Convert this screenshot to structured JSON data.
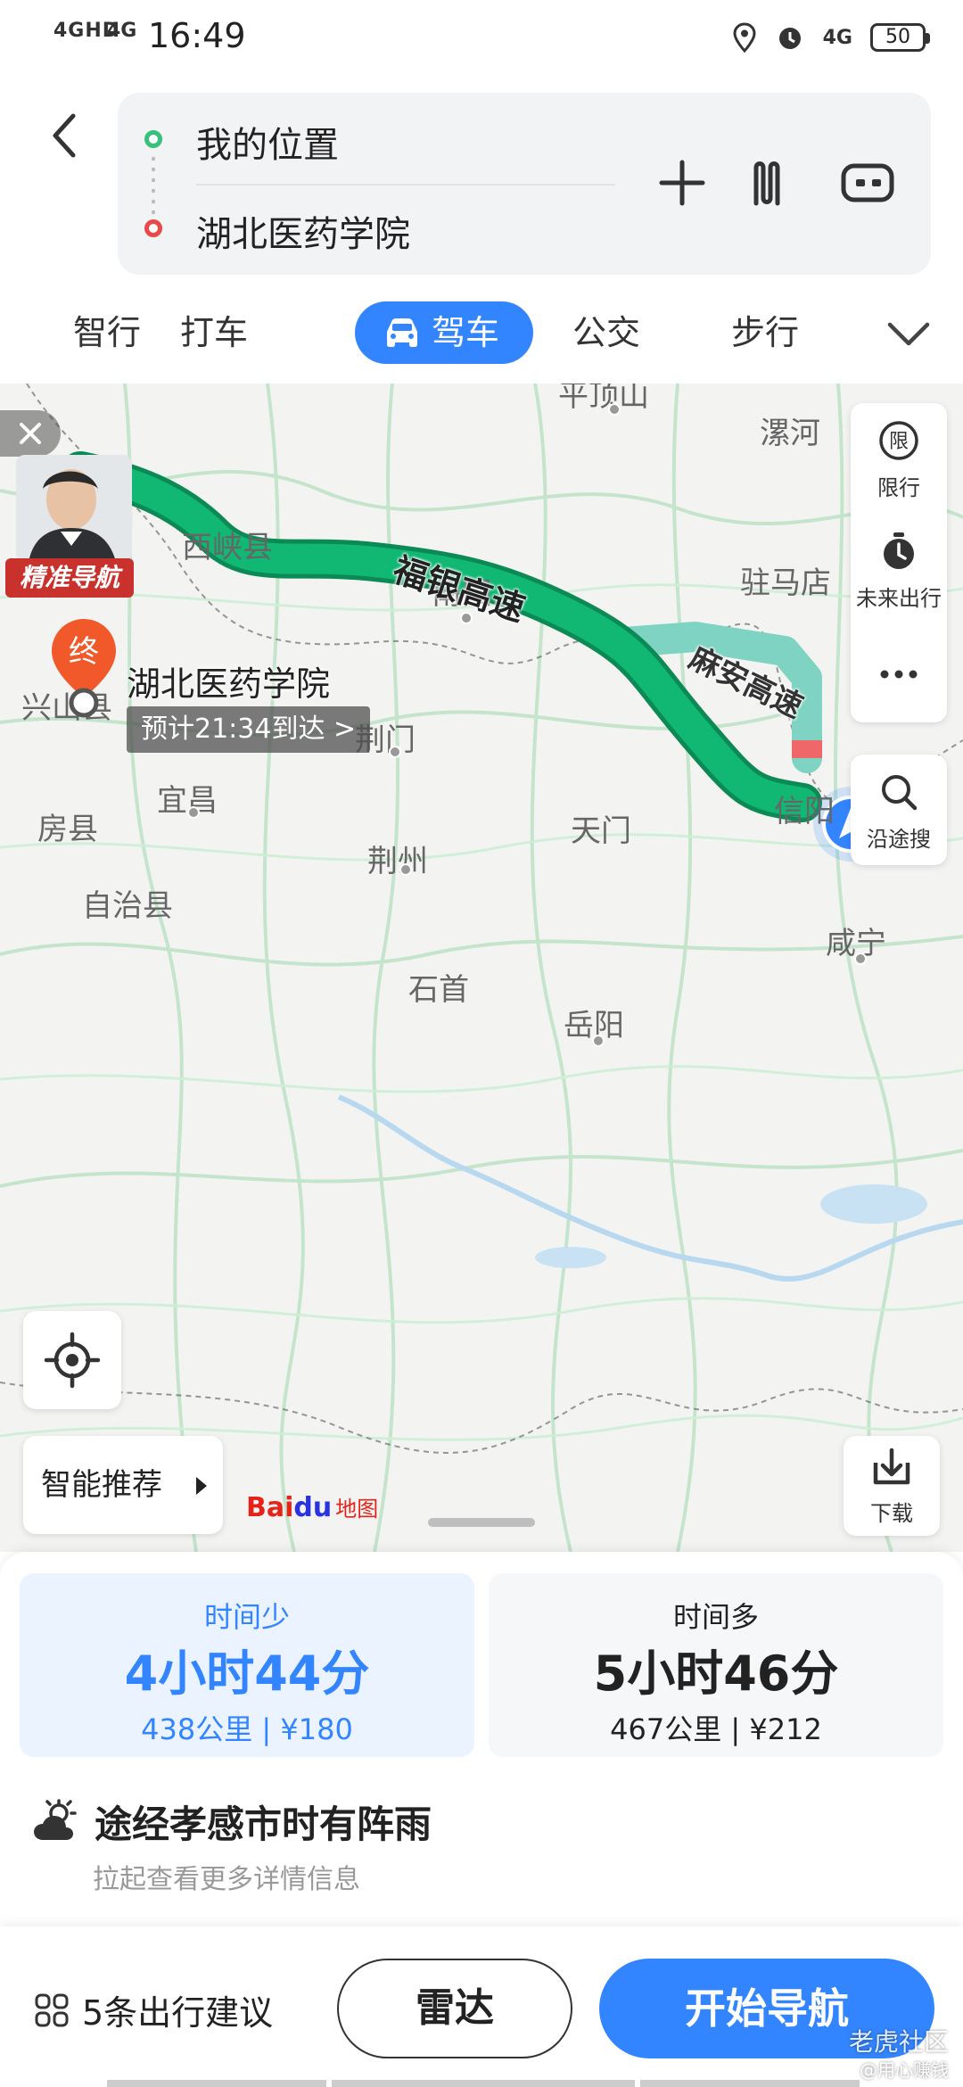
{
  "status_bar": {
    "net1": "4GHD",
    "net2": "4G",
    "time": "16:49",
    "net3": "4G",
    "battery": "50"
  },
  "route": {
    "origin": "我的位置",
    "destination": "湖北医药学院"
  },
  "modes": [
    {
      "label": "智行"
    },
    {
      "label": "打车"
    },
    {
      "label": "驾车"
    },
    {
      "label": "公交"
    },
    {
      "label": "步行"
    }
  ],
  "map": {
    "promo_badge": "精准导航",
    "destination_name": "湖北医药学院",
    "eta": "预计21:34到达 >",
    "roads": {
      "main": "福银高速",
      "alt": "麻安高速"
    },
    "place_labels": [
      {
        "name": "平顶山"
      },
      {
        "name": "漯河"
      },
      {
        "name": "西峡县"
      },
      {
        "name": "南阳"
      },
      {
        "name": "驻马店"
      },
      {
        "name": "信阳"
      },
      {
        "name": "房县"
      },
      {
        "name": "兴山县"
      },
      {
        "name": "荆门"
      },
      {
        "name": "宜昌"
      },
      {
        "name": "天门"
      },
      {
        "name": "荆州"
      },
      {
        "name": "自治县"
      },
      {
        "name": "咸宁"
      },
      {
        "name": "石首"
      },
      {
        "name": "岳阳"
      }
    ],
    "side_panel": {
      "restrict": "限行",
      "future": "未来出行",
      "search_along": "沿途搜"
    },
    "restrict_glyph": "限",
    "smart_recommend": "智能推荐",
    "download": "下载",
    "logo": {
      "bai": "Bai",
      "paw": "du",
      "map": "地图"
    },
    "colors": {
      "route_main": "#10b873",
      "route_alt": "#7fd3c2",
      "congestion": "#f0676a",
      "accent": "#3385ff"
    }
  },
  "routes": [
    {
      "tag": "时间少",
      "duration": "4小时44分",
      "meta": "438公里 | ¥180",
      "selected": true
    },
    {
      "tag": "时间多",
      "duration": "5小时46分",
      "meta": "467公里 | ¥212",
      "selected": false
    }
  ],
  "weather": {
    "text": "途经孝感市时有阵雨",
    "sub": "拉起查看更多详情信息"
  },
  "actions": {
    "advice": "5条出行建议",
    "radar": "雷达",
    "navigate": "开始导航"
  },
  "watermark": {
    "main": "老虎社区",
    "sub": "@用心赚钱"
  }
}
